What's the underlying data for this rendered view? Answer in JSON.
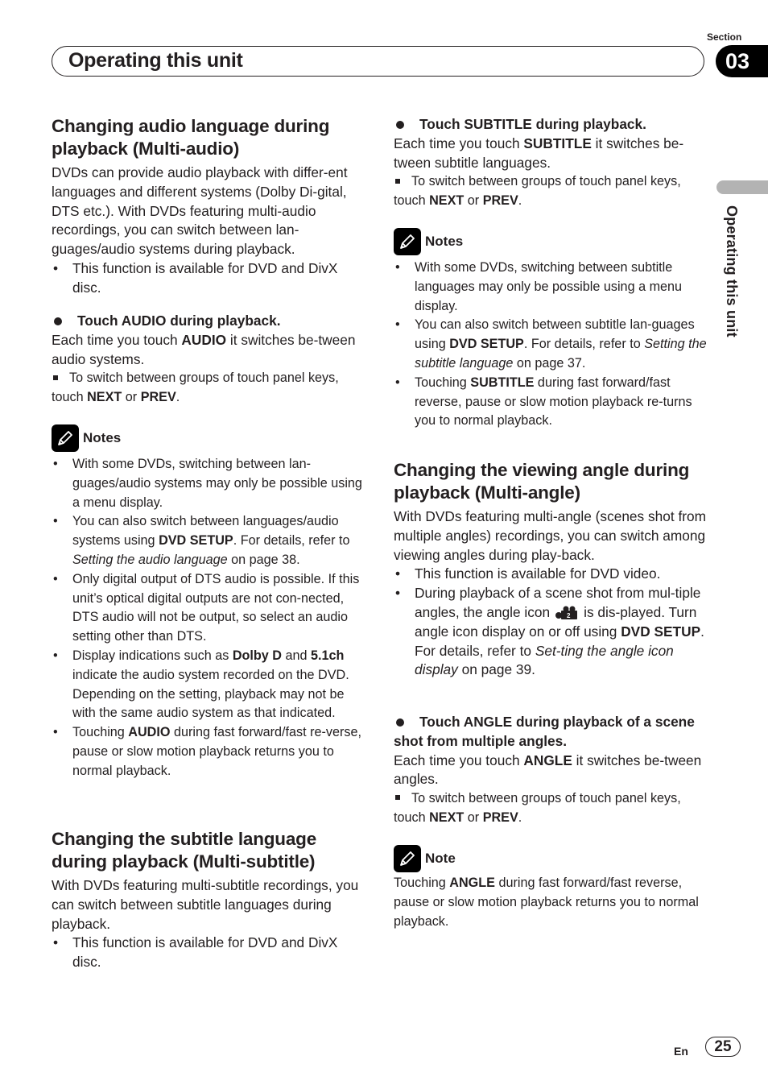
{
  "header": {
    "section_label": "Section",
    "section_number": "03",
    "title": "Operating this unit",
    "side_tab_label": "Operating this unit"
  },
  "left": {
    "audio": {
      "heading": "Changing audio language during playback (Multi-audio)",
      "intro": "DVDs can provide audio playback with differ-ent languages and different systems (Dolby Di-gital, DTS etc.). With DVDs featuring multi-audio recordings, you can switch between lan-guages/audio systems during playback.",
      "availability": "This function is available for DVD and DivX disc.",
      "step": "Touch AUDIO during playback.",
      "step_desc_pre": "Each time you touch ",
      "step_desc_key": "AUDIO",
      "step_desc_post": " it switches be-tween audio systems.",
      "sub_pre": "To switch between groups of touch panel keys, touch ",
      "sub_key1": "NEXT",
      "sub_mid": " or ",
      "sub_key2": "PREV",
      "sub_post": ".",
      "notes_title": "Notes",
      "notes": {
        "n1": "With some DVDs, switching between lan-guages/audio systems may only be possible using a menu display.",
        "n2_pre": "You can also switch between languages/audio systems using ",
        "n2_key": "DVD SETUP",
        "n2_mid": ". For details, refer to ",
        "n2_ref": "Setting the audio language",
        "n2_post": " on page 38.",
        "n3": "Only digital output of DTS audio is possible. If this unit’s optical digital outputs are not con-nected, DTS audio will not be output, so select an audio setting other than DTS.",
        "n4_pre": "Display indications such as ",
        "n4_key1": "Dolby D",
        "n4_mid": " and ",
        "n4_key2": "5.1ch",
        "n4_post": " indicate the audio system recorded on the DVD. Depending on the setting, playback may not be with the same audio system as that indicated.",
        "n5_pre": "Touching ",
        "n5_key": "AUDIO",
        "n5_post": " during fast forward/fast re-verse, pause or slow motion playback returns you to normal playback."
      }
    },
    "subtitle": {
      "heading": "Changing the subtitle language during playback (Multi-subtitle)",
      "intro": "With DVDs featuring multi-subtitle recordings, you can switch between subtitle languages during playback.",
      "availability": "This function is available for DVD and DivX disc."
    }
  },
  "right": {
    "subtitle_step": {
      "step": "Touch SUBTITLE during playback.",
      "step_desc_pre": "Each time you touch ",
      "step_desc_key": "SUBTITLE",
      "step_desc_post": " it switches be-tween subtitle languages.",
      "sub_pre": "To switch between groups of touch panel keys, touch ",
      "sub_key1": "NEXT",
      "sub_mid": " or ",
      "sub_key2": "PREV",
      "sub_post": ".",
      "notes_title": "Notes",
      "notes": {
        "n1": "With some DVDs, switching between subtitle languages may only be possible using a menu display.",
        "n2_pre": "You can also switch between subtitle lan-guages using ",
        "n2_key": "DVD SETUP",
        "n2_mid": ". For details, refer to ",
        "n2_ref": "Setting the subtitle language",
        "n2_post": " on page 37.",
        "n3_pre": "Touching ",
        "n3_key": "SUBTITLE",
        "n3_post": " during fast forward/fast reverse, pause or slow motion playback re-turns you to normal playback."
      }
    },
    "angle": {
      "heading": "Changing the viewing angle during playback (Multi-angle)",
      "intro": "With DVDs featuring multi-angle (scenes shot from multiple angles) recordings, you can switch among viewing angles during play-back.",
      "b1": "This function is available for DVD video.",
      "b2_pre": "During playback of a scene shot from mul-tiple angles, the angle icon",
      "b2_mid": "is dis-played. Turn angle icon display on or off using ",
      "b2_key": "DVD SETUP",
      "b2_mid2": ". For details, refer to ",
      "b2_ref": "Set-ting the angle icon display",
      "b2_post": " on page 39.",
      "step": "Touch ANGLE during playback of a scene shot from multiple angles.",
      "step_desc_pre": "Each time you touch ",
      "step_desc_key": "ANGLE",
      "step_desc_post": " it switches be-tween angles.",
      "sub_pre": "To switch between groups of touch panel keys, touch ",
      "sub_key1": "NEXT",
      "sub_mid": " or ",
      "sub_key2": "PREV",
      "sub_post": ".",
      "note_title": "Note",
      "note_pre": "Touching ",
      "note_key": "ANGLE",
      "note_post": " during fast forward/fast reverse, pause or slow motion playback returns you to normal playback."
    }
  },
  "footer": {
    "lang": "En",
    "page": "25"
  }
}
